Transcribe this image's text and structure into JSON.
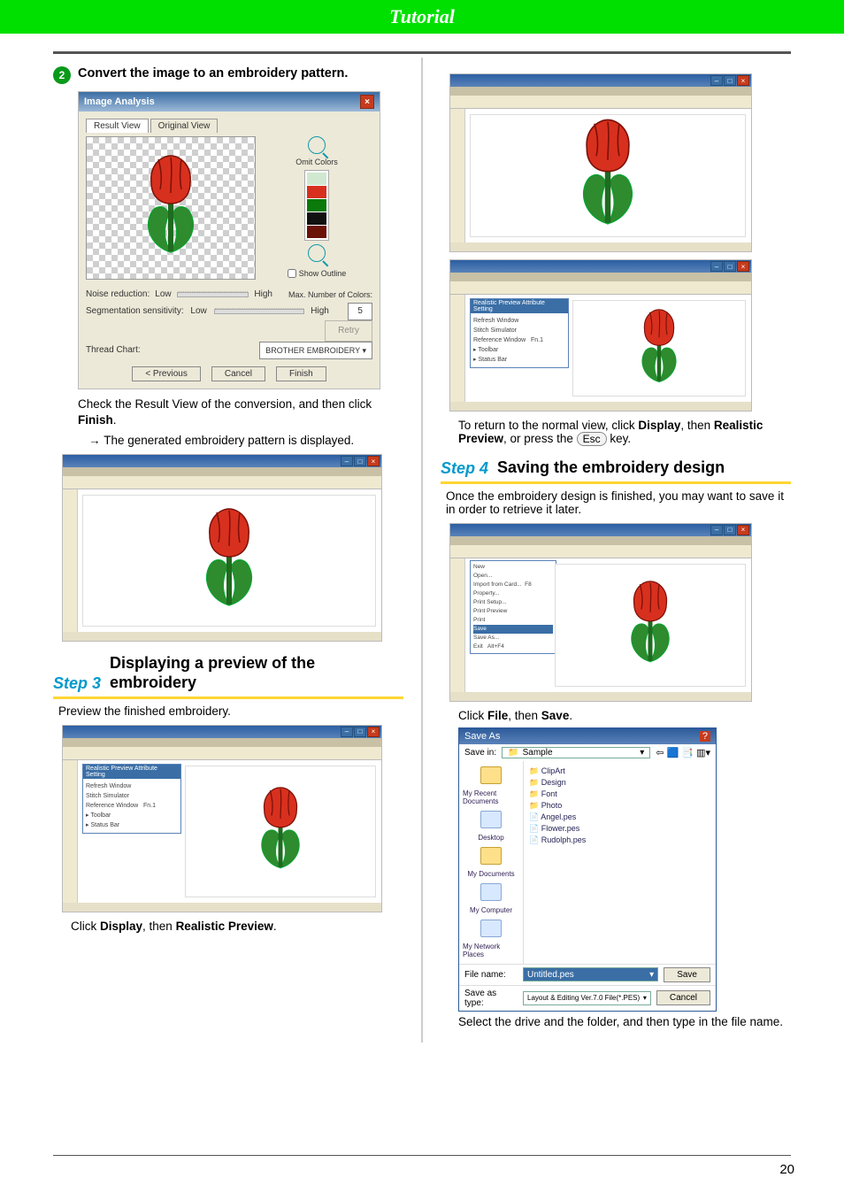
{
  "header": {
    "title": "Tutorial"
  },
  "left": {
    "step2_num": "2",
    "step2_heading": "Convert the image to an embroidery pattern.",
    "dlg": {
      "title": "Image Analysis",
      "tab_result": "Result View",
      "tab_original": "Original View",
      "omit_colors": "Omit Colors",
      "show_outline": "Show Outline",
      "noise_label": "Noise reduction:",
      "seg_label": "Segmentation sensitivity:",
      "low": "Low",
      "high": "High",
      "max_colors": "Max. Number of Colors:",
      "max_value": "5",
      "retry": "Retry",
      "thread_label": "Thread Chart:",
      "thread_value": "BROTHER EMBROIDERY",
      "btn_prev": "< Previous",
      "btn_cancel": "Cancel",
      "btn_finish": "Finish"
    },
    "check_text_a": "Check the Result View of the conversion, and then click ",
    "check_text_b": "Finish",
    "check_text_c": ".",
    "arrow_text": "The generated embroidery pattern is displayed.",
    "step3_label": "Step 3",
    "step3_title": "Displaying a preview of the embroidery",
    "step3_intro": "Preview the finished embroidery.",
    "step3_caption_a": "Click ",
    "step3_caption_b": "Display",
    "step3_caption_c": ", then ",
    "step3_caption_d": "Realistic Preview",
    "step3_caption_e": "."
  },
  "right": {
    "return_a": "To return to the normal view, click ",
    "return_b": "Display",
    "return_c": ", then ",
    "return_d": "Realistic Preview",
    "return_e": ", or press the ",
    "return_key": "Esc",
    "return_f": " key.",
    "step4_label": "Step 4",
    "step4_title": "Saving the embroidery design",
    "step4_intro": "Once the embroidery design is finished, you may want to save it in order to retrieve it later.",
    "save_caption_a": "Click ",
    "save_caption_b": "File",
    "save_caption_c": ", then ",
    "save_caption_d": "Save",
    "save_caption_e": ".",
    "savebox": {
      "title": "Save As",
      "savein_label": "Save in:",
      "savein_value": "Sample",
      "places": [
        "My Recent Documents",
        "Desktop",
        "My Documents",
        "My Computer",
        "My Network Places"
      ],
      "files": [
        "ClipArt",
        "Design",
        "Font",
        "Photo",
        "Angel.pes",
        "Flower.pes",
        "Rudolph.pes"
      ],
      "fname_label": "File name:",
      "fname_value": "Untitled.pes",
      "ftype_label": "Save as type:",
      "ftype_value": "Layout & Editing Ver.7.0 File(*.PES)",
      "btn_save": "Save",
      "btn_cancel": "Cancel"
    },
    "select_text": "Select the drive and the folder, and then type in the file name."
  },
  "page_number": "20"
}
